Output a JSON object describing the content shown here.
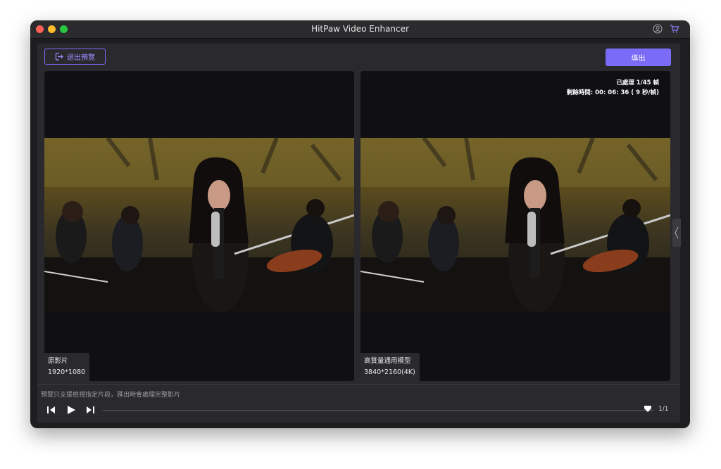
{
  "window": {
    "title": "HitPaw Video Enhancer"
  },
  "toolbar": {
    "exit_label": "退出預覽",
    "export_label": "導出"
  },
  "original": {
    "label": "原影片",
    "resolution": "1920*1080"
  },
  "enhanced": {
    "label": "高質量通用模型",
    "resolution": "3840*2160(4K)"
  },
  "progress": {
    "processed": "已處理 1/45 幀",
    "remaining": "剩餘時間: 00: 06: 36 ( 9 秒/幀)"
  },
  "footer": {
    "hint": "預覽只支援檢視指定片段，匯出時會處理完整影片",
    "page": "1/1"
  },
  "icons": [
    "account-icon",
    "cart-icon",
    "exit-icon",
    "prev-frame-icon",
    "play-icon",
    "next-frame-icon",
    "timeline-handle-icon",
    "collapse-icon"
  ],
  "colors": {
    "accent": "#7a6cf7",
    "background": "#1e1e21"
  }
}
